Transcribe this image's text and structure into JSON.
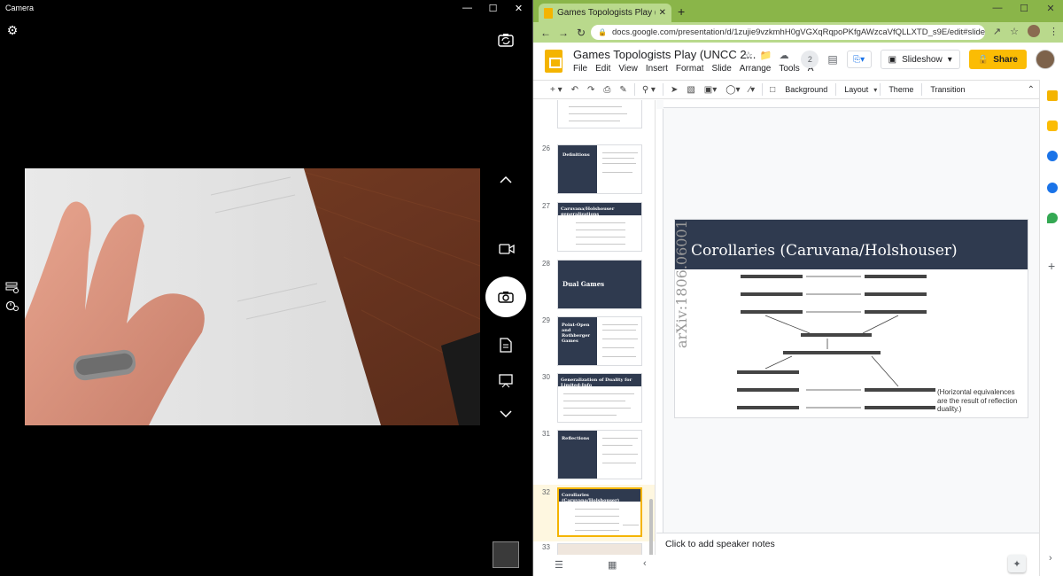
{
  "camera": {
    "title": "Camera",
    "icons": [
      "gear-icon",
      "switch-camera-icon",
      "chevron-up-icon",
      "video-icon",
      "photo-camera-icon",
      "document-icon",
      "whiteboard-icon",
      "chevron-down-icon",
      "grid-settings-icon",
      "timer-icon"
    ]
  },
  "browser": {
    "tab_title": "Games Topologists Play (UNCC 2...",
    "url": "docs.google.com/presentation/d/1zujie9vzkmhH0gVGXqRqpoPKfgAWzcaVfQLLXTD_s9E/edit#slide=id.gd6..."
  },
  "docs": {
    "title": "Games Topologists Play (UNCC 2...",
    "menus": [
      "File",
      "Edit",
      "View",
      "Insert",
      "Format",
      "Slide",
      "Arrange",
      "Tools",
      "A"
    ],
    "collaborators": "2",
    "slideshow_label": "Slideshow",
    "share_label": "Share",
    "toolbar_text": [
      "Background",
      "Layout",
      "Theme",
      "Transition"
    ]
  },
  "filmstrip": [
    {
      "num": "",
      "title": "",
      "type": "white"
    },
    {
      "num": "26",
      "title": "Definitions",
      "type": "dark-left"
    },
    {
      "num": "27",
      "title": "Caruvana/Holshouser generalizations",
      "type": "banner"
    },
    {
      "num": "28",
      "title": "Dual Games",
      "type": "dark-full"
    },
    {
      "num": "29",
      "title": "Point-Open and Rothberger Games",
      "type": "dark-left"
    },
    {
      "num": "30",
      "title": "Generalization of Duality for Limited-Info",
      "type": "banner"
    },
    {
      "num": "31",
      "title": "Reflections",
      "type": "dark-left"
    },
    {
      "num": "32",
      "title": "Corollaries (Caruvana/Holshouser)",
      "type": "banner",
      "selected": true
    },
    {
      "num": "33",
      "title": "",
      "type": "white"
    }
  ],
  "slide": {
    "title": "Corollaries (Caruvana/Holshouser)",
    "arxiv": "arXiv:1806.06001",
    "note": "(Horizontal equivalences are the result of reflection duality.)"
  },
  "notes": {
    "placeholder": "Click to add speaker notes"
  },
  "colors": {
    "slide_dark": "#2f3a4f",
    "share_yellow": "#fbbc04",
    "chrome_green": "#8ab549",
    "tab_green": "#b9d98c"
  }
}
